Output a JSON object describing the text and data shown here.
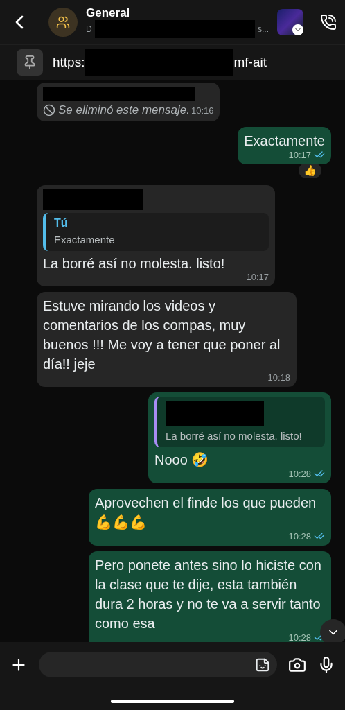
{
  "header": {
    "title": "General",
    "subtitle_start": "D",
    "subtitle_end": "s..."
  },
  "pinned": {
    "link_start": "https:",
    "link_end": "mf-ait"
  },
  "messages": [
    {
      "kind": "deleted",
      "outgoing": false,
      "sender_redacted": true,
      "text": "Se eliminó este mensaje.",
      "time": "10:16"
    },
    {
      "kind": "text",
      "outgoing": true,
      "text": "Exactamente",
      "time": "10:17",
      "read": true,
      "reaction": "👍"
    },
    {
      "kind": "reply",
      "outgoing": false,
      "sender_redacted": true,
      "quote_author": "Tú",
      "quote_text": "Exactamente",
      "text": "La borré así no molesta. listo!",
      "time": "10:17"
    },
    {
      "kind": "text",
      "outgoing": false,
      "text": "Estuve mirando los videos y comentarios de los compas, muy buenos !!! Me voy a tener que poner al día!! jeje",
      "time": "10:18"
    },
    {
      "kind": "reply",
      "outgoing": true,
      "quote_author_redacted": true,
      "quote_text": "La borré así no molesta. listo!",
      "text": "Nooo 🤣",
      "time": "10:28",
      "read": true
    },
    {
      "kind": "text",
      "outgoing": true,
      "text": "Aprovechen el finde los que pueden 💪💪💪",
      "time": "10:28",
      "read": true
    },
    {
      "kind": "text",
      "outgoing": true,
      "text": "Pero ponete antes sino lo hiciste con la clase que te dije, esta también dura 2 horas y no te va a servir tanto como esa",
      "time": "10:28",
      "read": true
    }
  ]
}
